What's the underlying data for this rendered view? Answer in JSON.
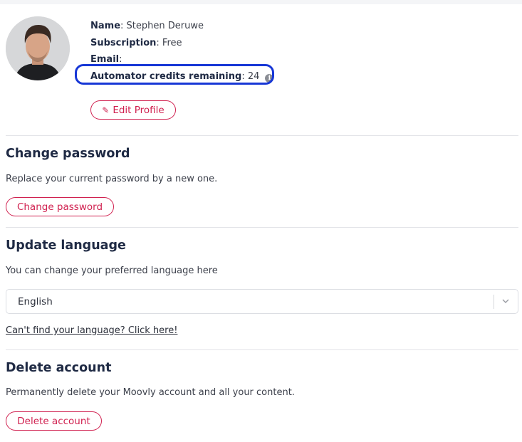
{
  "profile": {
    "name_label": "Name",
    "name_value": "Stephen Deruwe",
    "subscription_label": "Subscription",
    "subscription_value": "Free",
    "email_label": "Email",
    "email_value": "",
    "credits_label": "Automator credits remaining",
    "credits_value": "24",
    "edit_label": "Edit Profile"
  },
  "change_password": {
    "title": "Change password",
    "description": "Replace your current password by a new one.",
    "button_label": "Change password"
  },
  "update_language": {
    "title": "Update language",
    "description": "You can change your preferred language here",
    "selected": "English",
    "help_link": "Can't find your language? Click here!"
  },
  "delete_account": {
    "title": "Delete account",
    "description": "Permanently delete your Moovly account and all your content.",
    "button_label": "Delete account"
  },
  "colors": {
    "accent": "#d0204f",
    "heading": "#1f2a44",
    "highlight": "#1737d6"
  },
  "icons": [
    "avatar",
    "info-icon",
    "pencil-icon",
    "chevron-down-icon"
  ]
}
